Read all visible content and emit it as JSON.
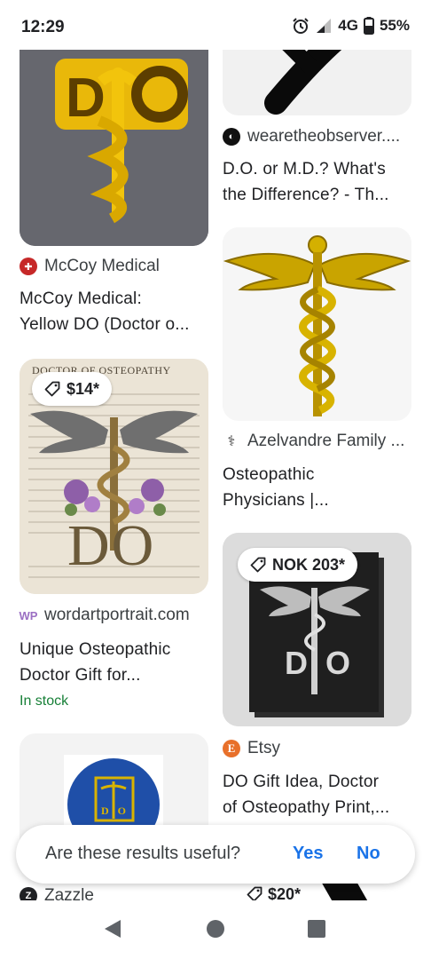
{
  "status_bar": {
    "time": "12:29",
    "network": "4G",
    "battery": "55%"
  },
  "results": {
    "r1": {
      "source": "McCoy Medical",
      "title_line1": "McCoy Medical:",
      "title_line2": "Yellow DO (Doctor o..."
    },
    "r2": {
      "source": "wearetheobserver....",
      "title_line1": "D.O. or M.D.? What's",
      "title_line2": "the Difference? - Th..."
    },
    "r3": {
      "source": "Azelvandre Family ...",
      "title_line1": "Osteopathic",
      "title_line2": "Physicians |..."
    },
    "r4": {
      "price": "$14*",
      "image_header": "DOCTOR OF OSTEOPATHY",
      "image_letters": "DO",
      "source": "wordartportrait.com",
      "title_line1": "Unique Osteopathic",
      "title_line2": "Doctor Gift for...",
      "stock": "In stock"
    },
    "r5": {
      "price": "NOK 203*",
      "image_letters": "DO",
      "source": "Etsy",
      "title_line1": "DO Gift Idea, Doctor",
      "title_line2": "of Osteopathy Print,..."
    },
    "r6": {
      "image_letters": "DO",
      "source": "Zazzle"
    },
    "r7": {
      "price": "$20*"
    }
  },
  "feedback": {
    "question": "Are these results useful?",
    "yes_label": "Yes",
    "no_label": "No"
  },
  "icons": {
    "alarm": "alarm-icon",
    "signal": "signal-icon",
    "battery": "battery-icon",
    "tag": "price-tag-icon",
    "back": "back-triangle-icon",
    "home": "home-circle-icon",
    "recents": "recents-square-icon"
  },
  "colors": {
    "link_blue": "#1a73e8",
    "stock_green": "#188038",
    "text": "#202124"
  }
}
